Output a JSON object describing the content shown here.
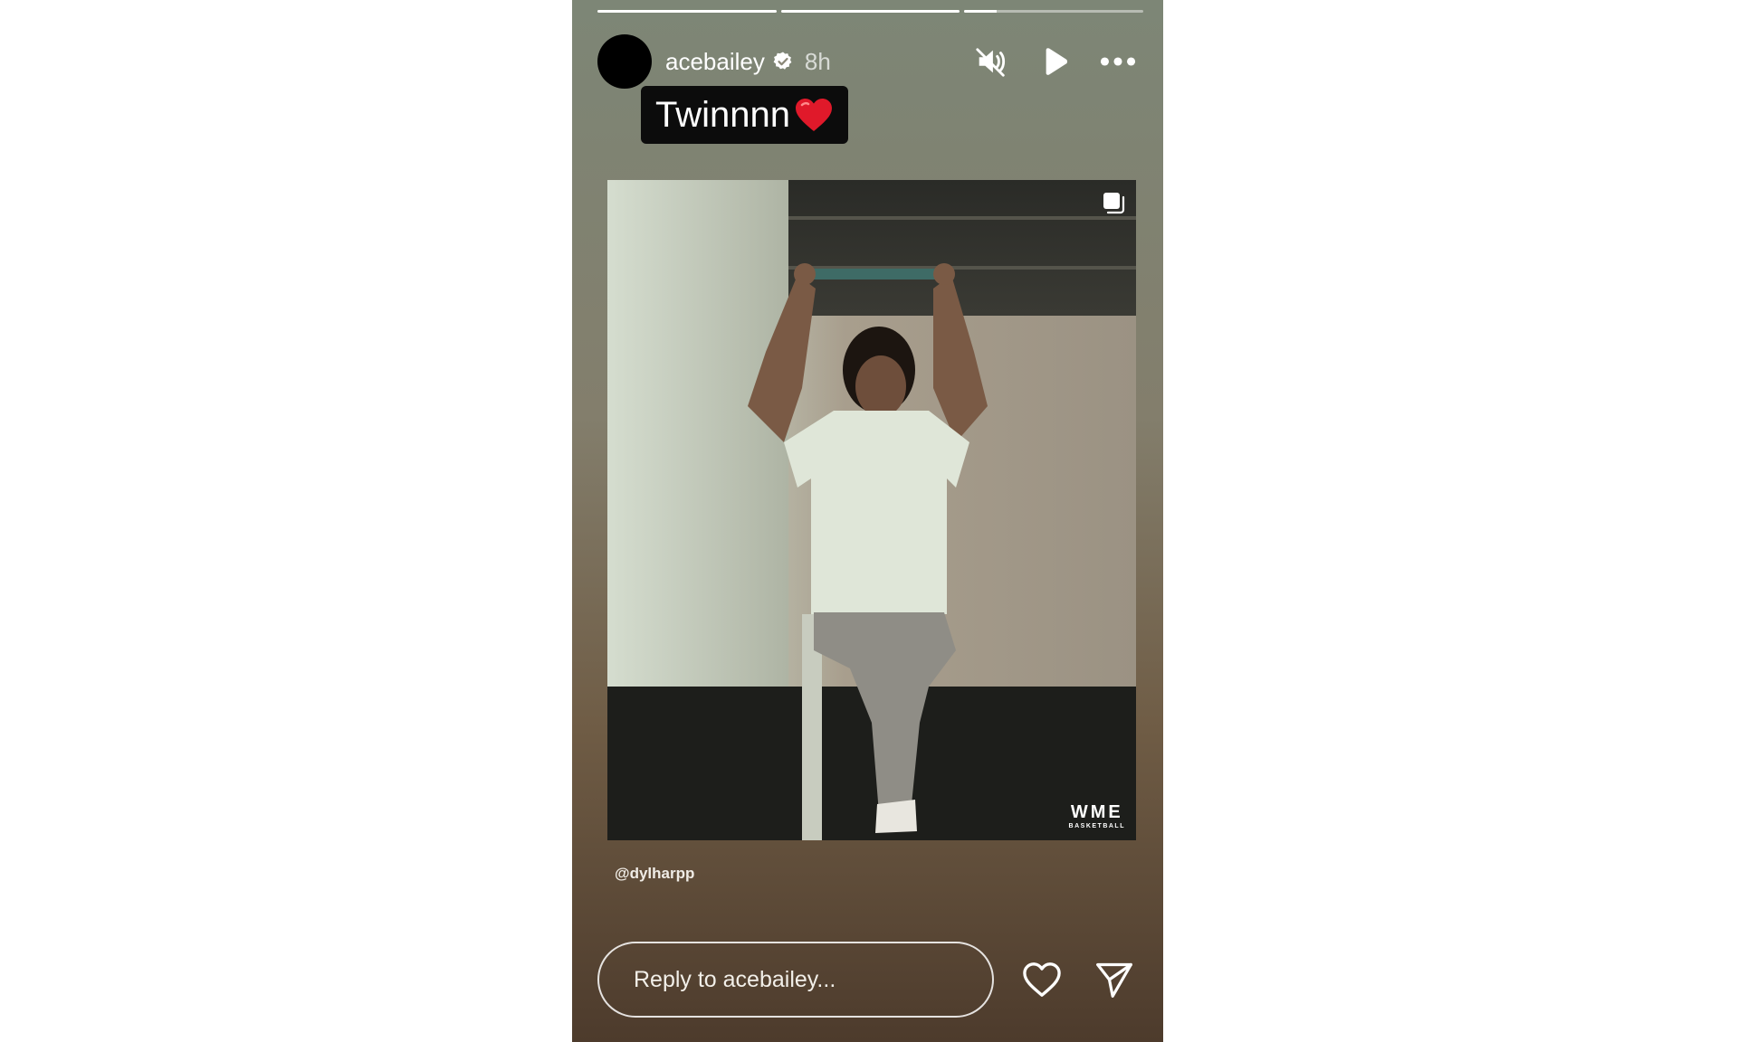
{
  "story": {
    "progress": [
      1,
      1,
      0.18
    ],
    "user": {
      "username": "acebailey",
      "time": "8h",
      "verified": true
    },
    "header_icons": [
      "muted-speaker-icon",
      "play-icon",
      "more-options-icon"
    ],
    "caption": {
      "text": "Twinnnn",
      "emoji": "red-heart"
    },
    "media": {
      "gallery_icon": "multiple-posts-icon",
      "watermark": {
        "main": "WME",
        "sub": "BASKETBALL"
      }
    },
    "mention": "@dylharpp",
    "reply": {
      "placeholder": "Reply to acebailey..."
    },
    "footer_icons": [
      "heart-icon",
      "send-icon"
    ]
  },
  "colors": {
    "caption_bg": "#0c0c0c",
    "heart": "#e0192a",
    "text": "#ffffff"
  }
}
